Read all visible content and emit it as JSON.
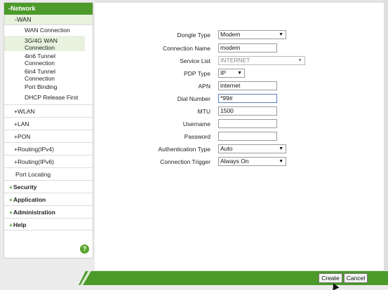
{
  "sidebar": {
    "network_label": "-Network",
    "wan_label": "-WAN",
    "wan_items": [
      {
        "label": "WAN Connection"
      },
      {
        "label": "3G/4G WAN Connection"
      },
      {
        "label": "4in6 Tunnel Connection"
      },
      {
        "label": "6in4 Tunnel Connection"
      },
      {
        "label": "Port Binding"
      },
      {
        "label": "DHCP Release First"
      }
    ],
    "network_items": [
      {
        "label": "+WLAN"
      },
      {
        "label": "+LAN"
      },
      {
        "label": "+PON"
      },
      {
        "label": "+Routing(IPv4)"
      },
      {
        "label": "+Routing(IPv6)"
      },
      {
        "label": "Port Locating"
      }
    ],
    "top_sections": [
      {
        "label": "Security"
      },
      {
        "label": "Application"
      },
      {
        "label": "Administration"
      },
      {
        "label": "Help"
      }
    ],
    "help_icon_glyph": "?"
  },
  "form": {
    "dongle_type": {
      "label": "Dongle Type",
      "value": "Modem"
    },
    "connection_name": {
      "label": "Connection Name",
      "value": "modem"
    },
    "service_list": {
      "label": "Service List",
      "value": "INTERNET"
    },
    "pdp_type": {
      "label": "PDP Type",
      "value": "IP"
    },
    "apn": {
      "label": "APN",
      "value": "internet"
    },
    "dial_number": {
      "label": "Dial Number",
      "value": "*99#"
    },
    "mtu": {
      "label": "MTU",
      "value": "1500"
    },
    "username": {
      "label": "Username",
      "value": ""
    },
    "password": {
      "label": "Password",
      "value": ""
    },
    "authentication_type": {
      "label": "Authentication Type",
      "value": "Auto"
    },
    "connection_trigger": {
      "label": "Connection Trigger",
      "value": "Always On"
    }
  },
  "actions": {
    "create_label": "Create",
    "cancel_label": "Cancel"
  },
  "colors": {
    "accent_green": "#4c9a2a",
    "selected_bg": "#e8f2df"
  },
  "icons": {
    "select_arrow": "chevron-down-icon",
    "help": "help-icon",
    "cursor": "mouse-pointer-icon"
  }
}
